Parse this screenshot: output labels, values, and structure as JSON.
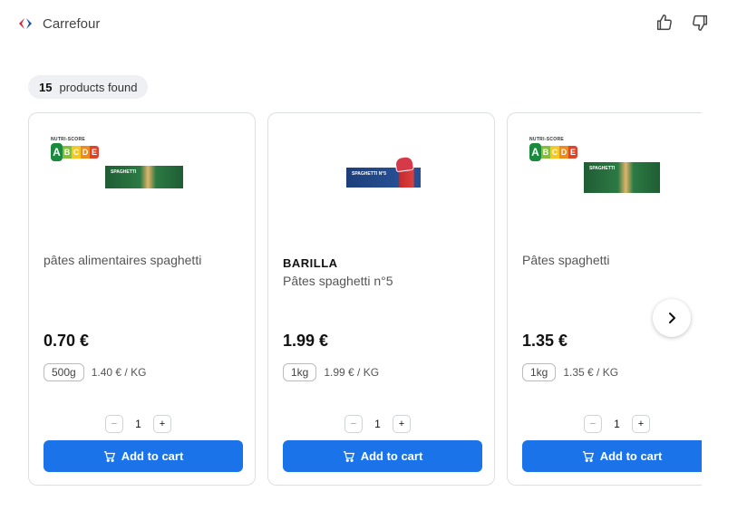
{
  "header": {
    "brand_name": "Carrefour",
    "brand_icon": "carrefour-logo",
    "thumb_up_icon": "thumbs-up-icon",
    "thumb_down_icon": "thumbs-down-icon"
  },
  "results": {
    "count": "15",
    "label": "products found"
  },
  "products": [
    {
      "brand": "",
      "title": "pâtes alimentaires spaghetti",
      "price": "0.70 €",
      "weight": "500g",
      "unit_price": "1.40 € / KG",
      "quantity": "1",
      "add_label": "Add to cart",
      "nutriscore": "A",
      "nutriscore_title": "NUTRI-SCORE",
      "nutriscore_letters": [
        "A",
        "B",
        "C",
        "D",
        "E"
      ],
      "package_text": "SPAGHETTI"
    },
    {
      "brand": "BARILLA",
      "title": "Pâtes spaghetti n°5",
      "price": "1.99 €",
      "weight": "1kg",
      "unit_price": "1.99 € / KG",
      "quantity": "1",
      "add_label": "Add to cart",
      "package_text": "SPAGHETTI N°5"
    },
    {
      "brand": "",
      "title": "Pâtes spaghetti",
      "price": "1.35 €",
      "weight": "1kg",
      "unit_price": "1.35 € / KG",
      "quantity": "1",
      "add_label": "Add to cart",
      "nutriscore": "A",
      "nutriscore_title": "NUTRI-SCORE",
      "nutriscore_letters": [
        "A",
        "B",
        "C",
        "D",
        "E"
      ],
      "package_text": "SPAGHETTI"
    }
  ],
  "stepper": {
    "minus": "−",
    "plus": "+"
  },
  "colors": {
    "accent": "#1a73e8",
    "nutri_a": "#1b8a3e"
  },
  "icons": {
    "cart": "cart-icon",
    "next": "chevron-right-icon"
  }
}
